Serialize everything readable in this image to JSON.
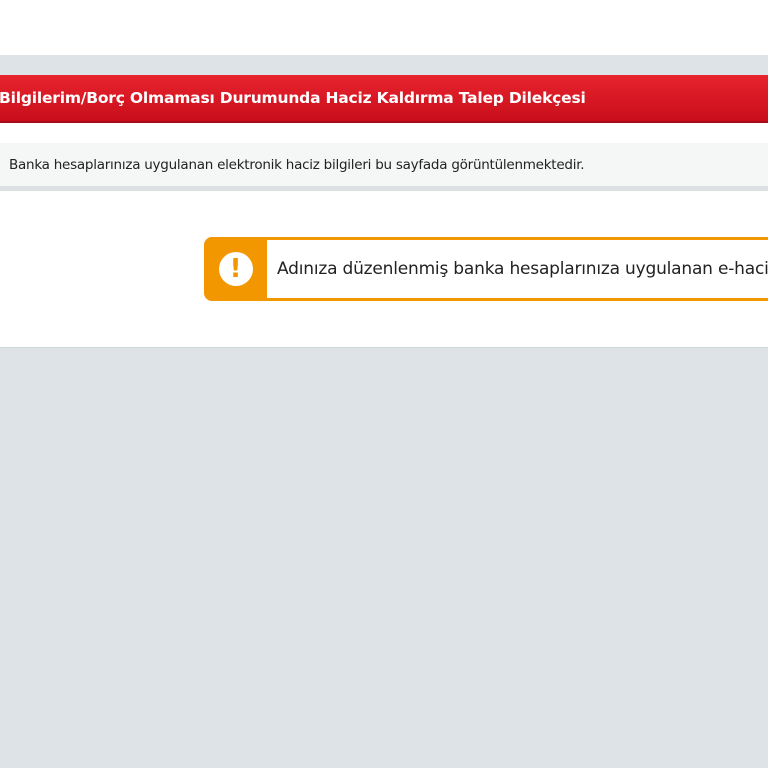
{
  "header": {
    "title": "Bilgilerim/Borç Olmaması Durumunda Haciz Kaldırma Talep Dilekçesi"
  },
  "info": {
    "text": "Banka hesaplarınıza uygulanan elektronik haciz bilgileri bu sayfada görüntülenmektedir."
  },
  "alert": {
    "icon": "exclamation-icon",
    "icon_glyph": "!",
    "text": "Adınıza düzenlenmiş banka hesaplarınıza uygulanan e-haciz bi",
    "color": "#f39700"
  },
  "colors": {
    "header": "#d9141f",
    "background": "#dde3e6"
  }
}
